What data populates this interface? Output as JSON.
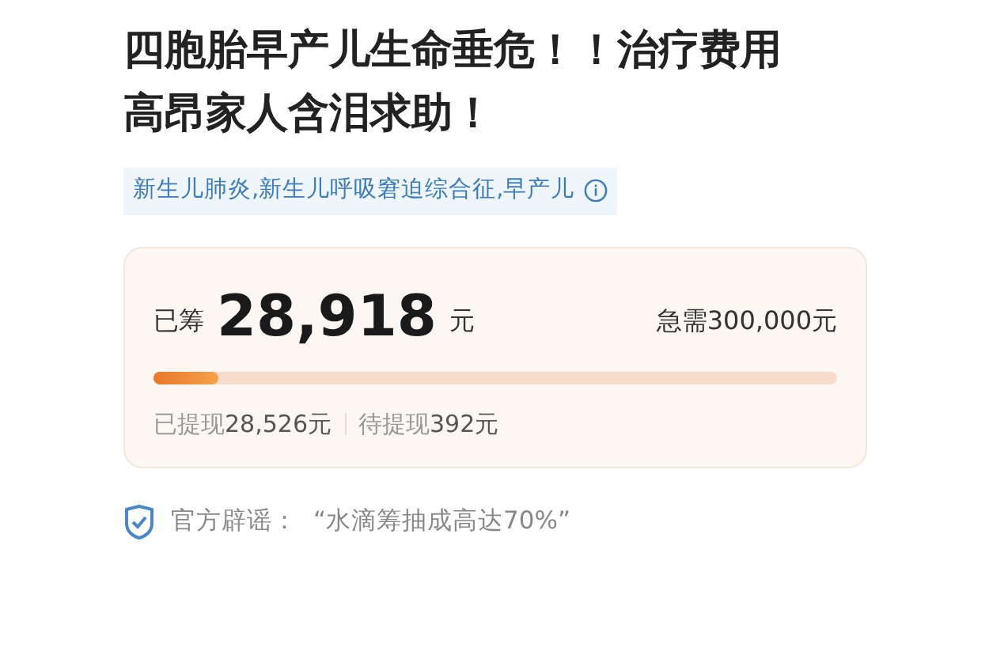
{
  "title": "四胞胎早产儿生命垂危！！治疗费用高昂家人含泪求助！",
  "tags": "新生儿肺炎,新生儿呼吸窘迫综合征,早产儿",
  "fundraising": {
    "raised_label": "已筹",
    "raised_amount": "28,918",
    "raised_unit": "元",
    "target": "急需300,000元",
    "level": 0.096,
    "withdrawn_label": "已提现",
    "withdrawn_amount": "28,526元",
    "pending_label": "待提现",
    "pending_amount": "392元"
  },
  "notice": {
    "label": "官方辟谣：",
    "text": "“水滴筹抽成高达70%”"
  }
}
